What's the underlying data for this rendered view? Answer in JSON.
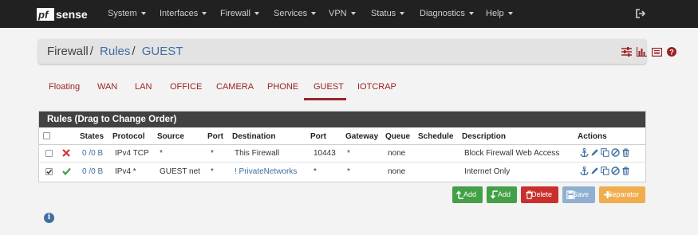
{
  "brand": {
    "logo_text": "pfsense",
    "accent": "#9b2324",
    "link": "#3f6ea3",
    "nav_bg": "#212121"
  },
  "nav": {
    "items": [
      "System",
      "Interfaces",
      "Firewall",
      "Services",
      "VPN",
      "Status",
      "Diagnostics",
      "Help"
    ],
    "logout_icon": "sign-out-icon"
  },
  "breadcrumb": {
    "root": "Firewall",
    "sep": "/",
    "level1": "Rules",
    "level2": "GUEST",
    "icons": [
      "sliders-icon",
      "bar-chart-icon",
      "list-log-icon",
      "help-icon"
    ]
  },
  "tabs": {
    "items": [
      "Floating",
      "WAN",
      "LAN",
      "OFFICE",
      "CAMERA",
      "PHONE",
      "GUEST",
      "IOTCRAP"
    ],
    "active": "GUEST"
  },
  "rules": {
    "title": "Rules (Drag to Change Order)",
    "columns": [
      "States",
      "Protocol",
      "Source",
      "Port",
      "Destination",
      "Port",
      "Gateway",
      "Queue",
      "Schedule",
      "Description",
      "Actions"
    ],
    "rows": [
      {
        "checked": false,
        "status": "blocked",
        "status_icon": "times-icon",
        "states": "0 /0 B",
        "protocol": "IPv4 TCP",
        "source": "*",
        "sport": "*",
        "destination": "This Firewall",
        "dport": "10443",
        "gateway": "*",
        "queue": "none",
        "schedule": "",
        "description": "Block Firewall Web Access"
      },
      {
        "checked": true,
        "status": "pass",
        "status_icon": "check-icon",
        "states": "0 /0 B",
        "protocol": "IPv4 *",
        "source": "GUEST net",
        "sport": "*",
        "destination": "! PrivateNetworks",
        "dport": "*",
        "gateway": "*",
        "queue": "none",
        "schedule": "",
        "description": "Internet Only"
      }
    ],
    "action_icons": [
      "anchor-icon",
      "pencil-icon",
      "copy-icon",
      "disable-icon",
      "trash-icon"
    ]
  },
  "buttons": {
    "add_top": "Add",
    "add_bottom": "Add",
    "delete": "Delete",
    "save": "Save",
    "separator": "Separator",
    "colors": {
      "add": "#43a047",
      "delete": "#d9534f",
      "save": "#8fb0d0",
      "separator": "#f0ad4e"
    }
  },
  "info_icon": "info-circle-icon"
}
